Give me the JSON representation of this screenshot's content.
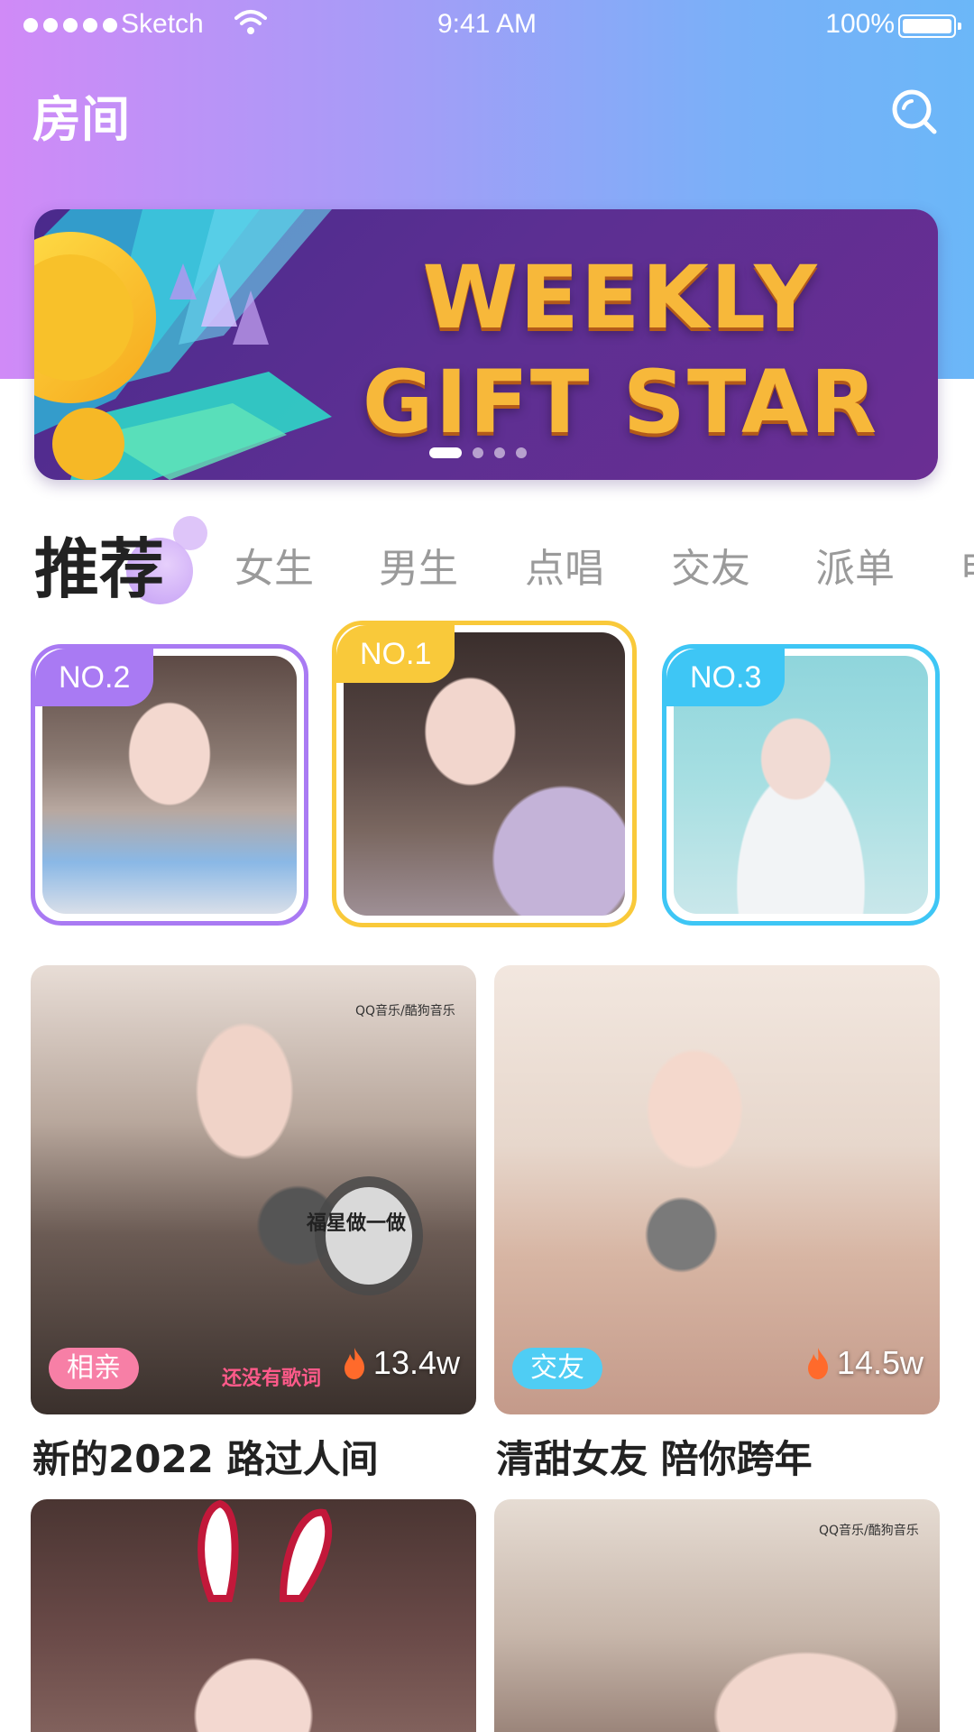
{
  "status_bar": {
    "carrier": "Sketch",
    "time": "9:41 AM",
    "battery": "100%"
  },
  "header": {
    "title": "房间",
    "search_icon": "search-icon"
  },
  "banner": {
    "line1": "WEEKLY",
    "line2": "GIFT STAR",
    "page_count": 4,
    "active_page": 0
  },
  "tabs": [
    {
      "label": "推荐",
      "active": true
    },
    {
      "label": "女生",
      "active": false
    },
    {
      "label": "男生",
      "active": false
    },
    {
      "label": "点唱",
      "active": false
    },
    {
      "label": "交友",
      "active": false
    },
    {
      "label": "派单",
      "active": false
    },
    {
      "label": "电",
      "active": false
    }
  ],
  "rankings": [
    {
      "badge": "NO.2",
      "color": "#a97af3"
    },
    {
      "badge": "NO.1",
      "color": "#f9c93a"
    },
    {
      "badge": "NO.3",
      "color": "#3ec6f5"
    }
  ],
  "rooms": [
    {
      "title": "新的2022  路过人间",
      "tag": "相亲",
      "tag_color": "#f77fa6",
      "heat": "13.4w",
      "overlay_text": "福星做一做",
      "watermark": "QQ音乐/酷狗音乐",
      "side_text": "还没有歌词"
    },
    {
      "title": "清甜女友 陪你跨年",
      "tag": "交友",
      "tag_color": "#4fcdf4",
      "heat": "14.5w"
    },
    {
      "title": "",
      "tag": "",
      "heat": ""
    },
    {
      "title": "",
      "tag": "",
      "heat": "",
      "watermark": "QQ音乐/酷狗音乐"
    }
  ],
  "colors": {
    "header_gradient_start": "#d08af7",
    "header_gradient_end": "#6bb7f8",
    "banner_text": "#f7b83a",
    "tab_active": "#222222",
    "tab_inactive": "#9a9a9a",
    "flame": "#ff6a2b"
  }
}
